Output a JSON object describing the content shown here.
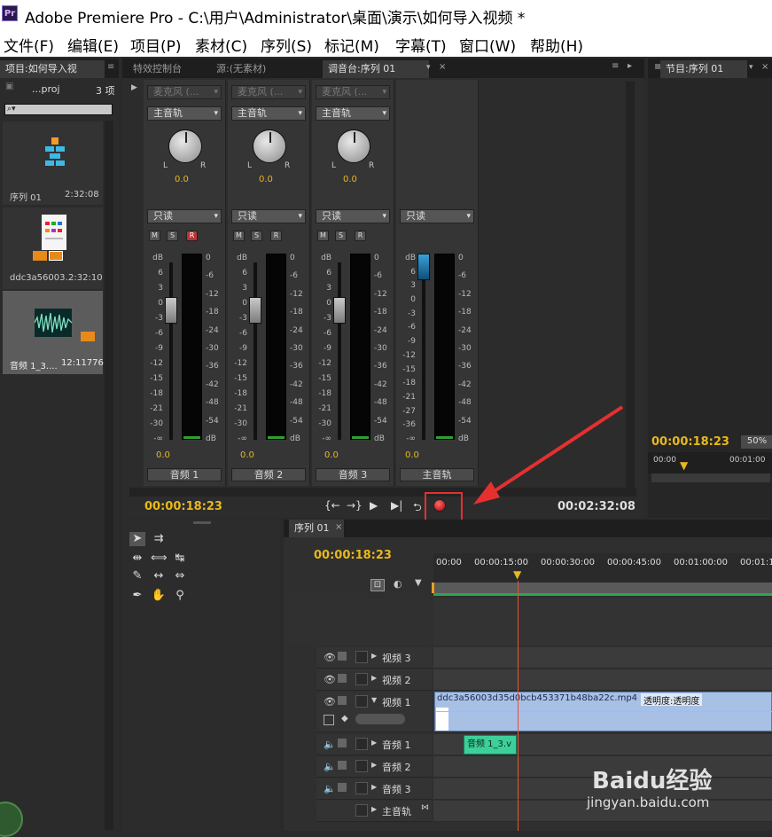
{
  "title": "Adobe Premiere Pro - C:\\用户\\Administrator\\桌面\\演示\\如何导入视频 *",
  "logo": "Pr",
  "menu": [
    "文件(F)",
    "编辑(E)",
    "项目(P)",
    "素材(C)",
    "序列(S)",
    "标记(M)",
    "字幕(T)",
    "窗口(W)",
    "帮助(H)"
  ],
  "project": {
    "tab": "项目:如何导入视",
    "name": "...proj",
    "count": "3 项",
    "items": [
      {
        "name": "序列 01",
        "dur": "2:32:08"
      },
      {
        "name": "ddc3a56003...",
        "dur": "2:32:10"
      },
      {
        "name": "音频 1_3....",
        "dur": "12:11776"
      }
    ]
  },
  "tabs": {
    "effects": "特效控制台",
    "source": "源:(无素材)",
    "mixer": "调音台:序列 01",
    "program": "节目:序列 01"
  },
  "mixer": {
    "channels": [
      {
        "input": "麦克风 (...",
        "route": "主音轨",
        "pan": "0.0",
        "mode": "只读",
        "vol": "0.0",
        "name": "音频 1",
        "r_active": true
      },
      {
        "input": "麦克风 (...",
        "route": "主音轨",
        "pan": "0.0",
        "mode": "只读",
        "vol": "0.0",
        "name": "音频 2",
        "r_active": false
      },
      {
        "input": "麦克风 (...",
        "route": "主音轨",
        "pan": "0.0",
        "mode": "只读",
        "vol": "0.0",
        "name": "音频 3",
        "r_active": false
      },
      {
        "mode": "只读",
        "vol": "0.0",
        "name": "主音轨"
      }
    ],
    "scale_left": [
      "dB",
      "6",
      "3",
      "0",
      "-3",
      "-6",
      "-9",
      "-12",
      "-15",
      "-18",
      "-21",
      "-30",
      "-∞"
    ],
    "scale_right": [
      "0",
      "-6",
      "-12",
      "-18",
      "-24",
      "-30",
      "-36",
      "-42",
      "-48",
      "-54",
      "dB"
    ],
    "master_scale": [
      "dB",
      "6",
      "3",
      "0",
      "-3",
      "-6",
      "-9",
      "-12",
      "-15",
      "-18",
      "-21",
      "-27",
      "-36",
      "-∞"
    ],
    "m": "M",
    "s": "S",
    "r": "R",
    "l": "L",
    "rr": "R",
    "tc_current": "00:00:18:23",
    "tc_total": "00:02:32:08"
  },
  "program": {
    "tc": "00:00:18:23",
    "zoom": "50%",
    "ruler0": "00:00",
    "ruler1": "00:01:00"
  },
  "timeline": {
    "tab": "序列 01",
    "tc": "00:00:18:23",
    "ruler": [
      "00:00",
      "00:00:15:00",
      "00:00:30:00",
      "00:00:45:00",
      "00:01:00:00",
      "00:01:1"
    ],
    "tracks": [
      {
        "name": "视频 3",
        "type": "video"
      },
      {
        "name": "视频 2",
        "type": "video"
      },
      {
        "name": "视频 1",
        "type": "video"
      },
      {
        "name": "音频 1",
        "type": "audio"
      },
      {
        "name": "音频 2",
        "type": "audio"
      },
      {
        "name": "音频 3",
        "type": "audio"
      },
      {
        "name": "主音轨",
        "type": "master"
      }
    ],
    "video_clip": "ddc3a56003d35d0bcb453371b48ba22c.mp4",
    "video_clip_fx": "透明度:透明度",
    "audio_clip": "音频 1_3.v"
  },
  "watermark": {
    "brand": "Baidu经验",
    "url": "jingyan.baidu.com"
  }
}
